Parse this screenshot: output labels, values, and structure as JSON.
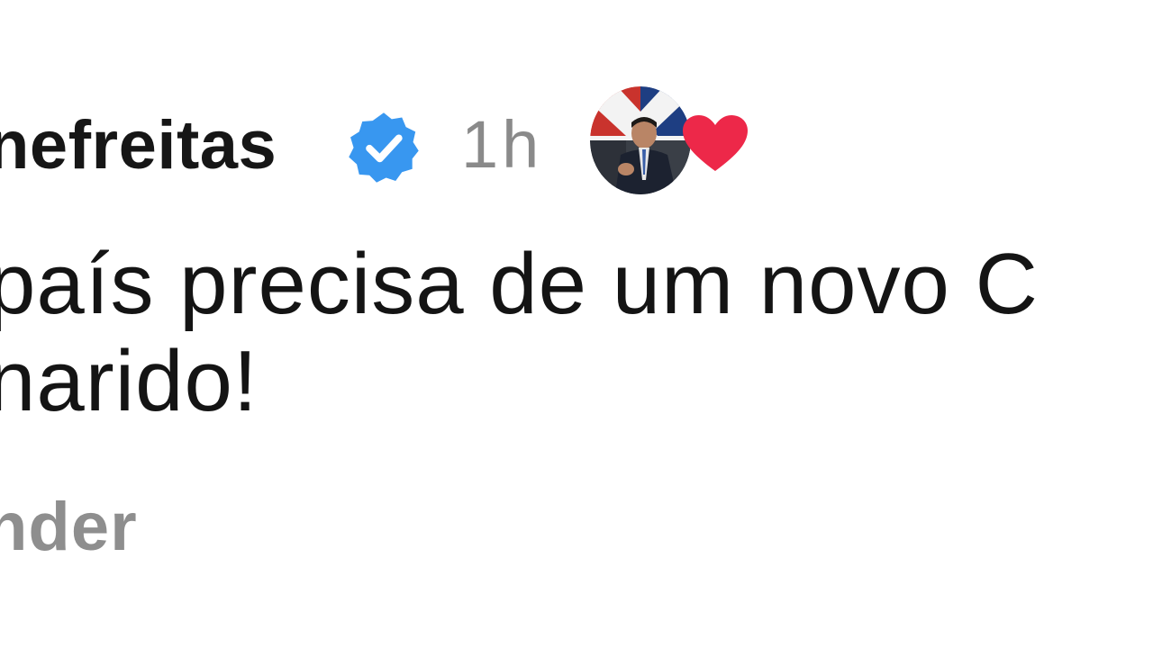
{
  "comment": {
    "username": "nefreitas",
    "timestamp": "1h",
    "verified_icon": "verified-badge-icon",
    "author_liked_icon": "heart-icon",
    "accent_color": "#3897f0",
    "heart_color": "#ed2849",
    "body_lines": [
      "país precisa de um novo C",
      "narido!"
    ],
    "reply_label": "nder"
  }
}
